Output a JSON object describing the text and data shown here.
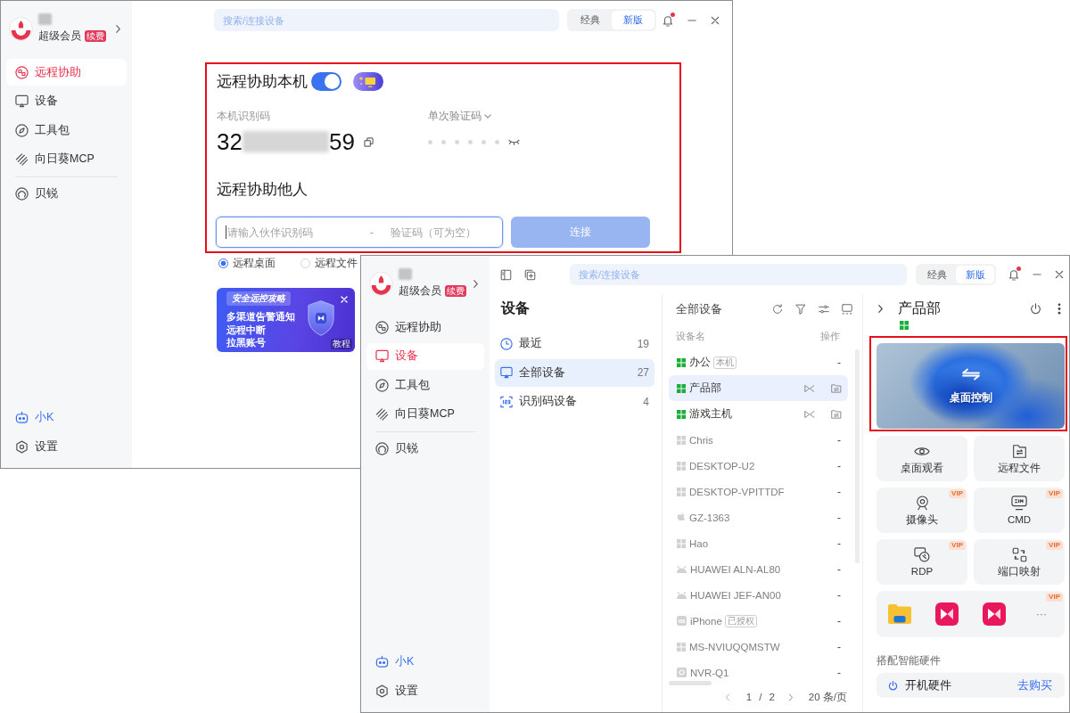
{
  "assist_window": {
    "profile": {
      "member": "超级会员",
      "badge": "续费"
    },
    "nav_groups": [
      [
        {
          "label": "远程协助",
          "selected": true
        },
        {
          "label": "设备",
          "selected": false
        },
        {
          "label": "工具包",
          "selected": false
        },
        {
          "label": "向日葵MCP",
          "selected": false
        }
      ],
      [
        {
          "label": "贝锐",
          "selected": false
        }
      ]
    ],
    "footer_nav": [
      {
        "label": "小K",
        "kind": "assistant"
      },
      {
        "label": "设置",
        "kind": "settings"
      }
    ],
    "search": {
      "placeholder": "搜索/连接设备"
    },
    "mode_switch": [
      {
        "label": "经典",
        "selected": false
      },
      {
        "label": "新版",
        "selected": true
      }
    ],
    "notifications": {
      "unread": true
    },
    "assist": {
      "highlighted": true,
      "self": {
        "title": "远程协助本机",
        "enabled": true,
        "id_label": "本机识别码",
        "id_start": "32",
        "id_end": "59",
        "code_label": "单次验证码",
        "code_hidden": true
      },
      "other": {
        "title": "远程协助他人",
        "partner_placeholder": "请输入伙伴识别码",
        "separator": "-",
        "code_placeholder": "验证码（可为空）",
        "focused": true,
        "connect_label": "连接",
        "connect_disabled": true
      }
    },
    "connect_modes": [
      {
        "label": "远程桌面",
        "selected": true
      },
      {
        "label": "远程文件",
        "selected": false
      }
    ],
    "promo": {
      "tag": "安全远控攻略",
      "lines": [
        "多渠道告警通知",
        "远程中断",
        "拉黑账号"
      ],
      "corner": "教程"
    }
  },
  "devices_window": {
    "profile": {
      "member": "超级会员",
      "badge": "续费"
    },
    "nav_groups": [
      [
        {
          "label": "远程协助",
          "selected": false
        },
        {
          "label": "设备",
          "selected": true
        },
        {
          "label": "工具包",
          "selected": false
        },
        {
          "label": "向日葵MCP",
          "selected": false
        }
      ],
      [
        {
          "label": "贝锐",
          "selected": false
        }
      ]
    ],
    "footer_nav": [
      {
        "label": "小K",
        "kind": "assistant"
      },
      {
        "label": "设置",
        "kind": "settings"
      }
    ],
    "search": {
      "placeholder": "搜索/连接设备"
    },
    "mode_switch": [
      {
        "label": "经典",
        "selected": false
      },
      {
        "label": "新版",
        "selected": true
      }
    ],
    "notifications": {
      "unread": true
    },
    "groups": {
      "title": "设备",
      "items": [
        {
          "label": "最近",
          "count": "19",
          "selected": false
        },
        {
          "label": "全部设备",
          "count": "27",
          "selected": true
        },
        {
          "label": "识别码设备",
          "count": "4",
          "selected": false
        }
      ]
    },
    "device_list": {
      "title": "全部设备",
      "columns": [
        "设备名",
        "操作"
      ],
      "rows": [
        {
          "name": "办公",
          "kind": "windows",
          "online": true,
          "tag": "本机",
          "selected": false,
          "quick_actions": false,
          "action": "-"
        },
        {
          "name": "产品部",
          "kind": "windows",
          "online": true,
          "selected": true,
          "quick_actions": true
        },
        {
          "name": "游戏主机",
          "kind": "windows",
          "online": true,
          "selected": false,
          "quick_actions": true
        },
        {
          "name": "Chris",
          "kind": "windows",
          "online": false,
          "selected": false,
          "quick_actions": false,
          "action": "-"
        },
        {
          "name": "DESKTOP-U2",
          "kind": "windows",
          "online": false,
          "selected": false,
          "quick_actions": false,
          "action": "-"
        },
        {
          "name": "DESKTOP-VPITTDF",
          "kind": "windows",
          "online": false,
          "selected": false,
          "quick_actions": false,
          "action": "-"
        },
        {
          "name": "GZ-1363",
          "kind": "apple",
          "online": false,
          "selected": false,
          "quick_actions": false,
          "action": "-"
        },
        {
          "name": "Hao",
          "kind": "windows",
          "online": false,
          "selected": false,
          "quick_actions": false,
          "action": "-"
        },
        {
          "name": "HUAWEI ALN-AL80",
          "kind": "android",
          "online": false,
          "selected": false,
          "quick_actions": false,
          "action": "-"
        },
        {
          "name": "HUAWEI JEF-AN00",
          "kind": "android",
          "online": false,
          "selected": false,
          "quick_actions": false,
          "action": "-"
        },
        {
          "name": "iPhone",
          "kind": "ios",
          "online": false,
          "tag": "已授权",
          "selected": false,
          "quick_actions": false,
          "action": "-"
        },
        {
          "name": "MS-NVIUQQMSTW",
          "kind": "windows",
          "online": false,
          "selected": false,
          "quick_actions": false,
          "action": "-"
        },
        {
          "name": "NVR-Q1",
          "kind": "nvr",
          "online": false,
          "selected": false,
          "quick_actions": false,
          "action": "-"
        }
      ],
      "pagination": {
        "page": "1",
        "separator": "/",
        "pages": "2",
        "page_size": "20 条/页"
      }
    },
    "detail": {
      "title": "产品部",
      "online": true,
      "desktop_control": {
        "label": "桌面控制",
        "highlighted": true
      },
      "tiles": [
        {
          "label": "桌面观看"
        },
        {
          "label": "远程文件"
        },
        {
          "label": "摄像头",
          "badge": "VIP"
        },
        {
          "label": "CMD",
          "badge": "VIP"
        },
        {
          "label": "RDP",
          "badge": "VIP"
        },
        {
          "label": "端口映射",
          "badge": "VIP"
        }
      ],
      "apps": {
        "items": [
          {
            "kind": "folder"
          },
          {
            "kind": "app"
          },
          {
            "kind": "app"
          }
        ],
        "more": "···",
        "badge": "VIP"
      },
      "hardware": {
        "title": "搭配智能硬件",
        "item": "开机硬件",
        "link": "去购买"
      }
    }
  }
}
